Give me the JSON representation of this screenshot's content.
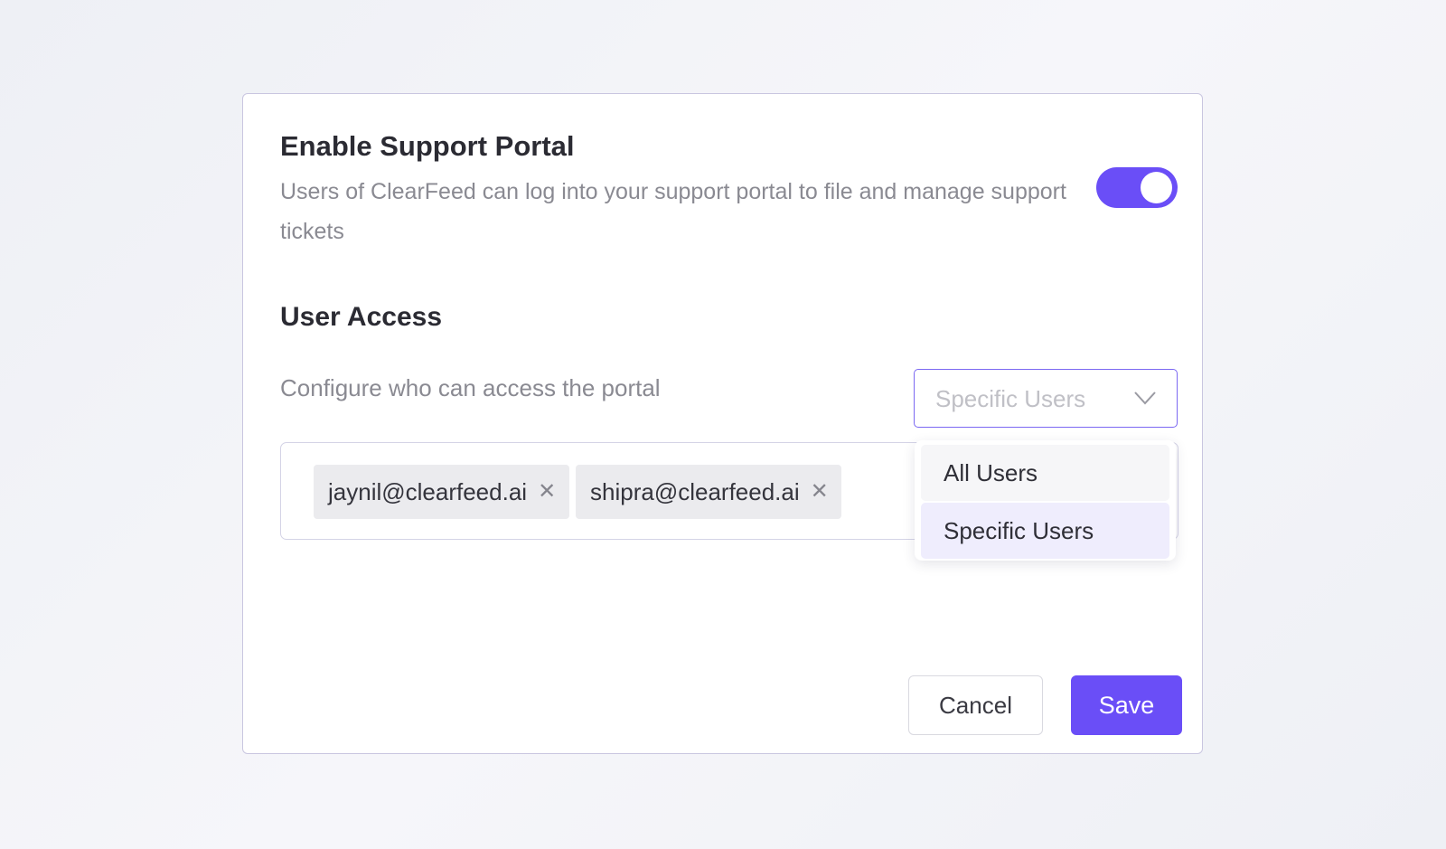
{
  "portal": {
    "title": "Enable Support Portal",
    "description": "Users of ClearFeed can log into your support portal to file and manage support tickets",
    "enabled": true,
    "accent_color": "#6a4ef7"
  },
  "access": {
    "title": "User Access",
    "config_label": "Configure who can access the portal",
    "select": {
      "value": "Specific Users",
      "icon": "chevron-down-icon"
    },
    "dropdown": {
      "options": [
        "All Users",
        "Specific Users"
      ],
      "selected": "Specific Users"
    },
    "users": [
      {
        "email": "jaynil@clearfeed.ai",
        "remove_icon": "close-icon"
      },
      {
        "email": "shipra@clearfeed.ai",
        "remove_icon": "close-icon"
      }
    ]
  },
  "actions": {
    "cancel_label": "Cancel",
    "save_label": "Save"
  }
}
